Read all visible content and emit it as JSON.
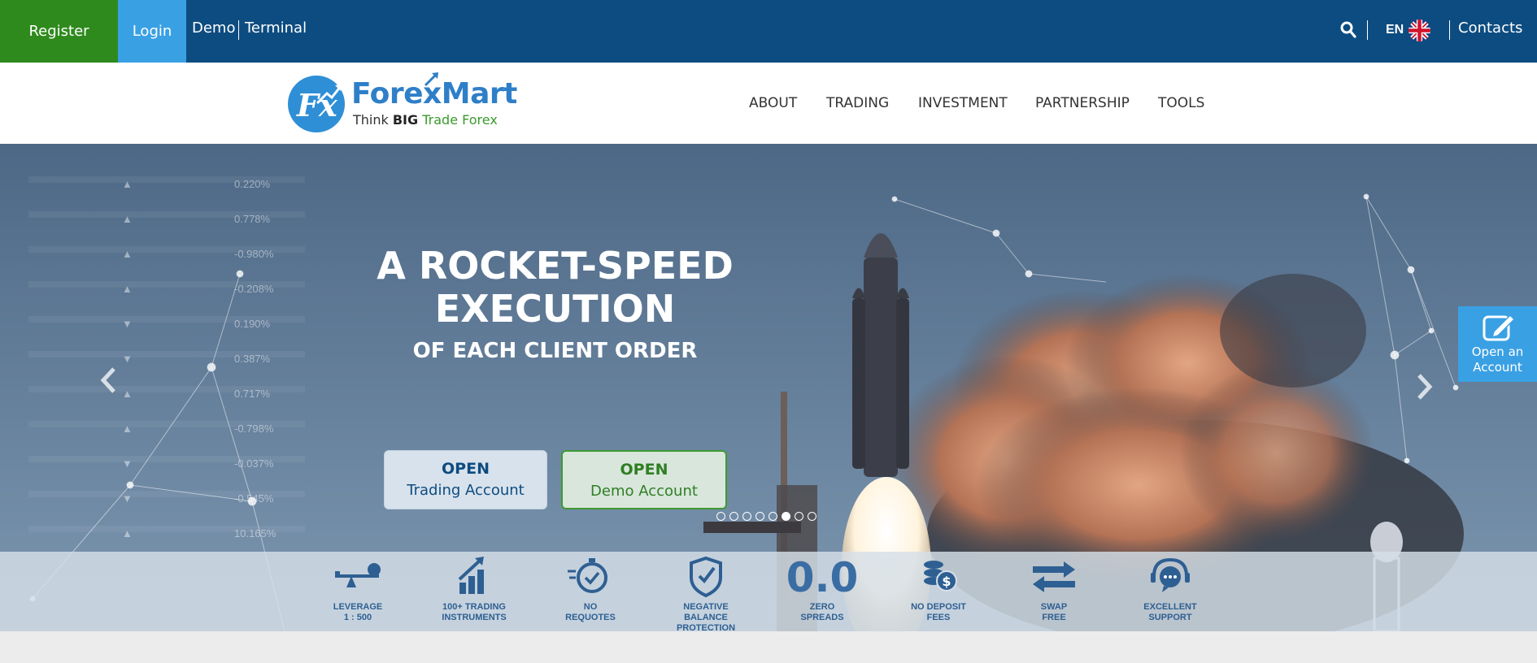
{
  "topbar": {
    "register": "Register",
    "login": "Login",
    "demo": "Demo",
    "terminal": "Terminal",
    "language": "EN",
    "contacts": "Contacts"
  },
  "logo": {
    "fx": "Fx",
    "name": "ForexMart",
    "tagline_think": "Think",
    "tagline_big": "BIG",
    "tagline_rest": "Trade Forex"
  },
  "nav": [
    "ABOUT",
    "TRADING",
    "INVESTMENT",
    "PARTNERSHIP",
    "TOOLS"
  ],
  "hero": {
    "headline_line1": "A ROCKET-SPEED",
    "headline_line2": "EXECUTION",
    "subheadline": "OF EACH CLIENT ORDER",
    "cta_trading": {
      "line1": "OPEN",
      "line2": "Trading Account"
    },
    "cta_demo": {
      "line1": "OPEN",
      "line2": "Demo Account"
    },
    "slide_count": 8,
    "active_slide": 6
  },
  "ticker": [
    {
      "dir": "up",
      "value": "0.220%"
    },
    {
      "dir": "up",
      "value": "0.778%"
    },
    {
      "dir": "up",
      "value": "-0.980%"
    },
    {
      "dir": "up",
      "value": "-0.208%"
    },
    {
      "dir": "down",
      "value": "0.190%"
    },
    {
      "dir": "down",
      "value": "0.387%"
    },
    {
      "dir": "up",
      "value": "0.717%"
    },
    {
      "dir": "up",
      "value": "-0.798%"
    },
    {
      "dir": "down",
      "value": "-0.037%"
    },
    {
      "dir": "down",
      "value": "-0.545%"
    },
    {
      "dir": "up",
      "value": "10.165%"
    }
  ],
  "open_account": {
    "line1": "Open an",
    "line2": "Account"
  },
  "features": [
    {
      "icon": "leverage-icon",
      "line1": "LEVERAGE",
      "line2": "1 : 500"
    },
    {
      "icon": "trading-instruments-icon",
      "line1": "100+ TRADING",
      "line2": "INSTRUMENTS"
    },
    {
      "icon": "stopwatch-icon",
      "line1": "NO",
      "line2": "REQUOTES"
    },
    {
      "icon": "shield-icon",
      "line1": "NEGATIVE BALANCE",
      "line2": "PROTECTION"
    },
    {
      "icon": "zero-spreads-icon",
      "big": "0.0",
      "line1": "ZERO",
      "line2": "SPREADS"
    },
    {
      "icon": "coins-icon",
      "line1": "NO DEPOSIT",
      "line2": "FEES"
    },
    {
      "icon": "swap-arrows-icon",
      "line1": "SWAP",
      "line2": "FREE"
    },
    {
      "icon": "support-chat-icon",
      "line1": "EXCELLENT",
      "line2": "SUPPORT"
    }
  ],
  "colors": {
    "topbar": "#0d4c80",
    "register": "#2f8a1d",
    "login": "#3aa0e4",
    "brand_blue": "#2f8fd6",
    "brand_green": "#3a9a2c"
  }
}
